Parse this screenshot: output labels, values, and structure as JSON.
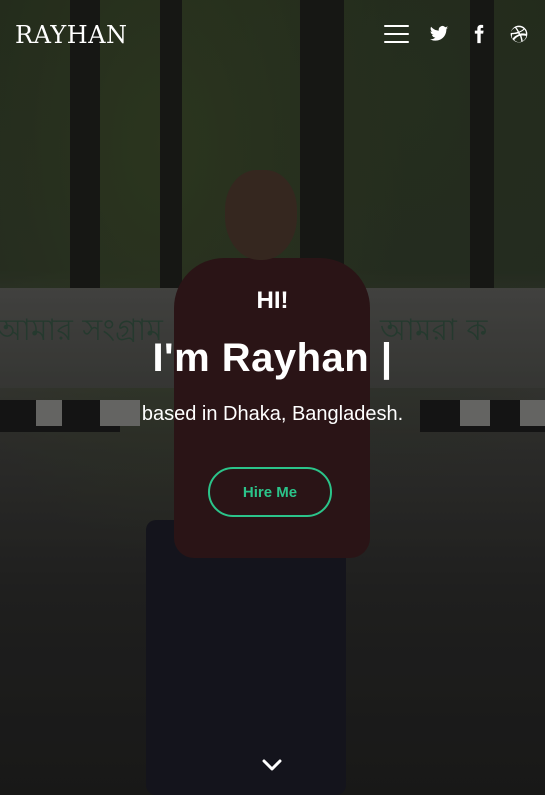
{
  "header": {
    "logo": "RAYHAN",
    "icons": [
      "menu-icon",
      "twitter-icon",
      "facebook-icon",
      "dribbble-icon"
    ]
  },
  "hero": {
    "greeting": "HI!",
    "headline": "I'm Rayhan |",
    "subline": "based in Dhaka, Bangladesh.",
    "cta_label": "Hire Me",
    "scroll_icon": "chevron-down-icon",
    "background_words": [
      "আমার সংগ্রাম",
      "আমরা ক"
    ]
  },
  "colors": {
    "accent": "#2bc48a",
    "text": "#ffffff"
  }
}
